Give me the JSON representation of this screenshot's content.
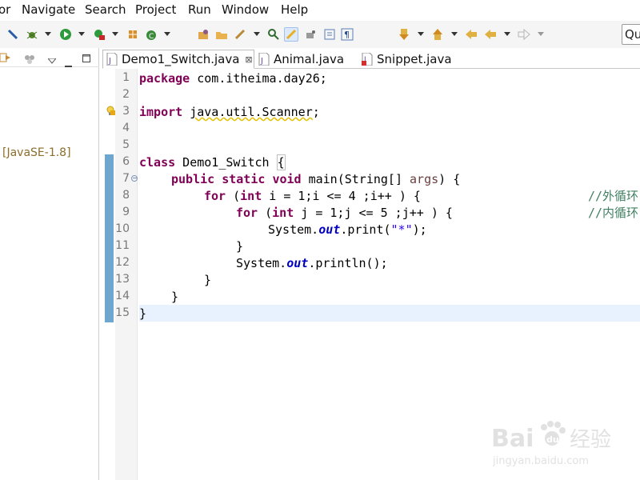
{
  "menu": [
    "or",
    "Navigate",
    "Search",
    "Project",
    "Run",
    "Window",
    "Help"
  ],
  "quick_access": "Qu",
  "left_panel": {
    "jre_label": "[JavaSE-1.8]"
  },
  "tabs": [
    {
      "label": "Demo1_Switch.java",
      "close": "⊠",
      "active": true
    },
    {
      "label": "Animal.java",
      "active": false
    },
    {
      "label": "Snippet.java",
      "active": false
    }
  ],
  "line_numbers": [
    "1",
    "2",
    "3",
    "4",
    "5",
    "6",
    "7",
    "8",
    "9",
    "10",
    "11",
    "12",
    "13",
    "14",
    "15"
  ],
  "code": {
    "l1": {
      "kw": "package",
      "rest": " com.itheima.day26;"
    },
    "l3": {
      "kw": "import",
      "sp": " ",
      "rest": "java.util.Scanner",
      "end": ";"
    },
    "l6": {
      "kw": "class",
      "mid": " Demo1_Switch ",
      "brace": "{"
    },
    "l7": {
      "kw1": "public",
      "kw2": "static",
      "kw3": "void",
      "mid": " main(String[] ",
      "param": "args",
      "end": ") {"
    },
    "l8": {
      "kw1": "for",
      "mid1": " (",
      "kw2": "int",
      "rest": " i = 1;i <= 4 ;i++ ) {",
      "comment": "//外循环"
    },
    "l9": {
      "kw1": "for",
      "mid1": " (",
      "kw2": "int",
      "rest": " j = 1;j <= 5 ;j++ ) {",
      "comment": "//内循环"
    },
    "l10": {
      "pre": "System.",
      "field": "out",
      "mid": ".print(",
      "str": "\"*\"",
      "end": ");"
    },
    "l11": "}",
    "l12": {
      "pre": "System.",
      "field": "out",
      "end": ".println();"
    },
    "l13": "}",
    "l14": "}",
    "l15": "}"
  },
  "watermark": {
    "brand": "Bai",
    "paw": "du",
    "cn": "经验",
    "url": "jingyan.baidu.com"
  },
  "colors": {
    "keyword": "#7f0055",
    "comment": "#3f7f5f",
    "string": "#2a00ff",
    "field": "#0000c0",
    "current_line": "#e8f2fe"
  }
}
